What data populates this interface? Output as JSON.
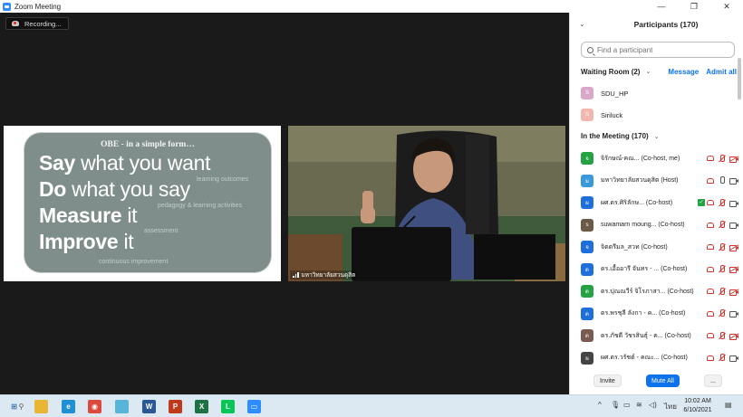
{
  "window": {
    "title": "Zoom Meeting",
    "controls": [
      "—",
      "❐",
      "✕"
    ]
  },
  "recording": {
    "label": "Recording..."
  },
  "slide": {
    "heading": "OBE -  in a simple form…",
    "lines": [
      {
        "bold": "Say",
        "rest": " what you want"
      },
      {
        "bold": "Do",
        "rest": " what you say"
      },
      {
        "bold": "Measure",
        "rest": " it"
      },
      {
        "bold": "Improve",
        "rest": " it"
      }
    ],
    "notes": [
      "learning outcomes",
      "pedagogy & learning activities",
      "assessment",
      "continuous improvement"
    ]
  },
  "camera": {
    "name": "มหาวิทยาลัยสวนดุสิต"
  },
  "participants": {
    "title": "Participants (170)",
    "search_placeholder": "Find a participant",
    "waiting_room": {
      "label": "Waiting Room (2)",
      "message": "Message",
      "admit_all": "Admit all",
      "people": [
        {
          "name": "SDU_HP",
          "initial": "S",
          "color": "#d9a8c9"
        },
        {
          "name": "Siriluck",
          "initial": "S",
          "color": "#f2b8b0"
        }
      ]
    },
    "in_meeting_label": "In the Meeting (170)",
    "people": [
      {
        "name": "จิรักษณ์-คณ... (Co-host, me)",
        "initial": "จ",
        "color": "#25a244",
        "mic": "muted",
        "cam": "off",
        "badge": ""
      },
      {
        "name": "มหาวิทยาลัยสวนดุสิต (Host)",
        "initial": "ม",
        "color": "#3a9ad9",
        "mic": "on",
        "cam": "on",
        "badge": ""
      },
      {
        "name": "ผศ.ดร.ศิริลักษ...  (Co-host)",
        "initial": "ผ",
        "color": "#1e6fd9",
        "mic": "muted",
        "cam": "on",
        "badge": "✓"
      },
      {
        "name": "suwamarn moung... (Co-host)",
        "initial": "s",
        "color": "#6b5a48",
        "mic": "muted",
        "cam": "on",
        "badge": ""
      },
      {
        "name": "จิตตรีมล_สวท (Co-host)",
        "initial": "จ",
        "color": "#1e6fd9",
        "mic": "muted",
        "cam": "off",
        "badge": ""
      },
      {
        "name": "ดร.เอื้ออารี จันทร - ... (Co-host)",
        "initial": "ด",
        "color": "#1e6fd9",
        "mic": "muted",
        "cam": "off",
        "badge": ""
      },
      {
        "name": "ดร.ปุณณวีร์ จิโรภาสา... (Co-host)",
        "initial": "ด",
        "color": "#25a244",
        "mic": "muted",
        "cam": "off",
        "badge": ""
      },
      {
        "name": "ดร.พรชุลี ลังกา - ค... (Co-host)",
        "initial": "ด",
        "color": "#1e6fd9",
        "mic": "muted",
        "cam": "on",
        "badge": ""
      },
      {
        "name": "ดร.ภัชดี วัชรสินธุ์ - ค... (Co-host)",
        "initial": "ด",
        "color": "#7a5a50",
        "mic": "muted",
        "cam": "off",
        "badge": ""
      },
      {
        "name": "ผศ.ดร.วรัชต์ - คณะ... (Co-host)",
        "initial": "ผ",
        "color": "#444",
        "mic": "muted",
        "cam": "on",
        "badge": ""
      }
    ],
    "footer": {
      "invite": "Invite",
      "mute_all": "Mute All",
      "more": "..."
    }
  },
  "taskbar": {
    "time": "10:02 AM",
    "date": "6/10/2021",
    "lang": "ไทย",
    "apps": [
      {
        "name": "windows",
        "glyph": "⊞",
        "color": "#1f5fa8"
      },
      {
        "name": "search",
        "glyph": "⚲",
        "color": "#555"
      },
      {
        "name": "file-explorer",
        "glyph": "",
        "color": "#e8b634"
      },
      {
        "name": "edge",
        "glyph": "e",
        "color": "#1f8fd6"
      },
      {
        "name": "chrome",
        "glyph": "◉",
        "color": "#dc4a3d"
      },
      {
        "name": "store",
        "glyph": "",
        "color": "#58b4d8"
      },
      {
        "name": "word",
        "glyph": "W",
        "color": "#2b5797"
      },
      {
        "name": "powerpoint",
        "glyph": "P",
        "color": "#c1391b"
      },
      {
        "name": "excel",
        "glyph": "X",
        "color": "#1e7145"
      },
      {
        "name": "line",
        "glyph": "L",
        "color": "#06c755"
      },
      {
        "name": "zoom",
        "glyph": "▭",
        "color": "#2d8cff"
      }
    ]
  }
}
